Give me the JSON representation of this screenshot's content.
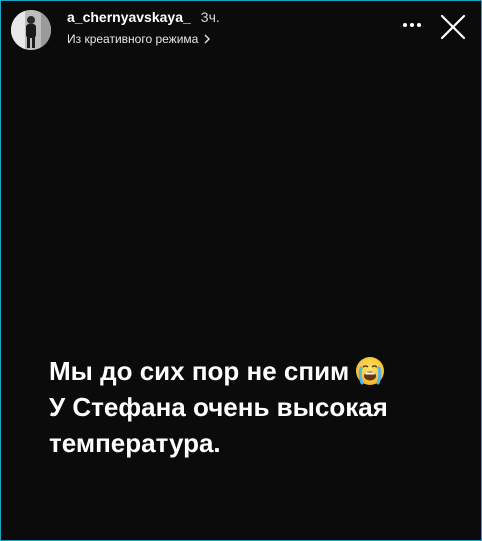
{
  "story": {
    "username": "a_chernyavskaya_",
    "time_ago": "3ч.",
    "subtitle": "Из креативного режима",
    "caption_lines": [
      "Мы до сих пор не спим",
      "У Стефана очень высокая",
      "температура."
    ],
    "caption_emoji": "crying-face-icon"
  },
  "icons": {
    "more": "more-dots-icon",
    "close": "close-icon",
    "subtitle_chevron": "chevron-right-icon"
  },
  "colors": {
    "background": "#0b0b0b",
    "text": "#ffffff",
    "frame_border": "#1aa4c8"
  }
}
